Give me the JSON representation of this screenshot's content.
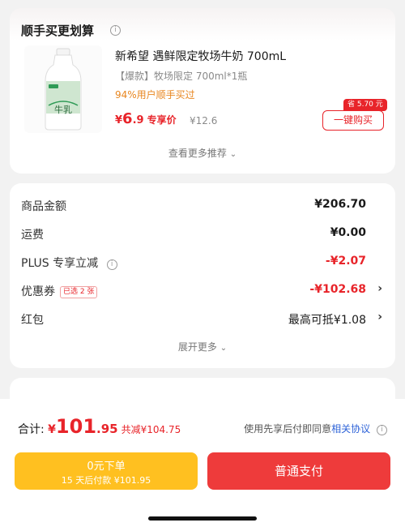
{
  "recommend": {
    "title": "顺手买更划算",
    "info_icon": "i",
    "product": {
      "name": "新希望 遇鲜限定牧场牛奶 700mL",
      "spec": "【爆款】牧场限定 700ml*1瓶",
      "stat": "94%用户顺手买过",
      "price_currency": "¥",
      "price_int": "6",
      "price_dec": ".9",
      "price_tag": "专享价",
      "original_price": "¥12.6",
      "save_badge": "省 5.70 元",
      "buy_label": "一键购买",
      "image_label": "牛乳"
    },
    "more": "查看更多推荐"
  },
  "summary": {
    "rows": [
      {
        "label": "商品金额",
        "value": "¥206.70"
      },
      {
        "label": "运费",
        "value": "¥0.00"
      },
      {
        "label": "PLUS 专享立减",
        "value": "-¥2.07"
      },
      {
        "label": "优惠券",
        "tag": "已选 2 张",
        "value": "-¥102.68"
      },
      {
        "label": "红包",
        "value": "最高可抵¥1.08"
      }
    ],
    "expand": "展开更多"
  },
  "footer": {
    "total_label": "合计: ",
    "total_currency": "¥",
    "total_int": "101",
    "total_dec": ".95",
    "discount": "共减¥104.75",
    "agree_prefix": "使用先享后付即同意",
    "agree_link": "相关协议",
    "paylater_line1": "0元下单",
    "paylater_line2": "15 天后付款 ¥101.95",
    "pay_label": "普通支付"
  },
  "colors": {
    "accent_red": "#e8242a",
    "paylater_yellow": "#ffc020",
    "link_blue": "#2e63d8",
    "stat_orange": "#e8861f"
  }
}
